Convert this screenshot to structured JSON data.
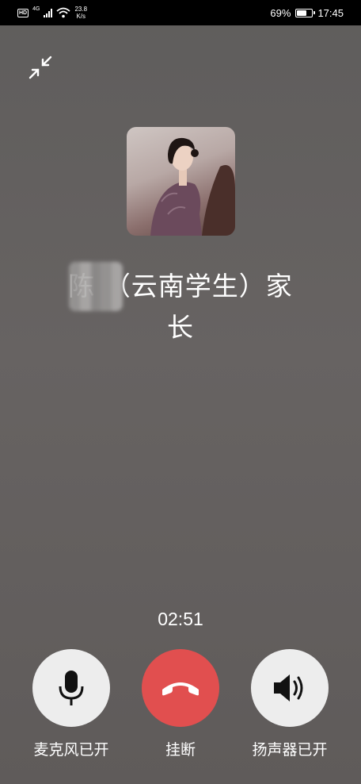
{
  "status_bar": {
    "hd": "HD",
    "network_type": "4G",
    "speed_value": "23.8",
    "speed_unit": "K/s",
    "battery_percent": "69%",
    "battery_level": 0.69,
    "time": "17:45"
  },
  "call": {
    "contact_name_line1": "陈 （云南学生）家",
    "contact_name_line2": "长",
    "timer": "02:51"
  },
  "controls": {
    "mic_label": "麦克风已开",
    "hangup_label": "挂断",
    "speaker_label": "扬声器已开",
    "hangup_color": "#e14f4f",
    "button_color": "#ededed"
  },
  "icons": [
    "minimize-icon",
    "microphone-icon",
    "hangup-phone-icon",
    "speaker-icon"
  ]
}
